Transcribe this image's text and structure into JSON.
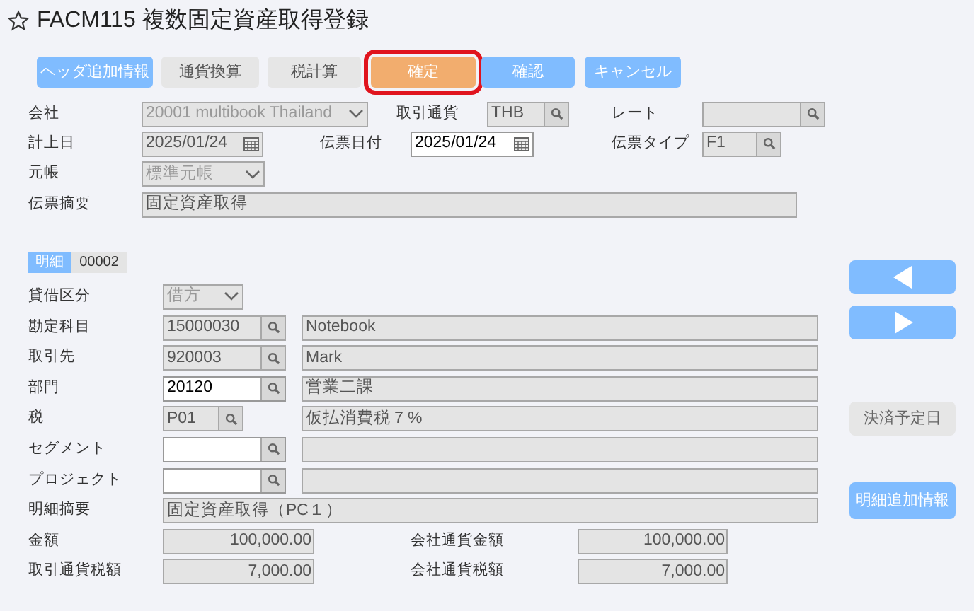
{
  "title": "FACM115 複数固定資産取得登録",
  "toolbar": [
    {
      "label": "ヘッダ追加情報",
      "kind": "primary"
    },
    {
      "label": "通貨換算",
      "kind": "secondary"
    },
    {
      "label": "税計算",
      "kind": "secondary"
    },
    {
      "label": "確定",
      "kind": "highlight"
    },
    {
      "label": "確認",
      "kind": "primary"
    },
    {
      "label": "キャンセル",
      "kind": "primary"
    }
  ],
  "header_rows": [
    [
      {
        "label": "会社",
        "value": "20001 multibook Thailand",
        "kind": "select",
        "editable": false
      },
      {
        "label": "取引通貨",
        "value": "THB",
        "kind": "lookup",
        "editable": false
      },
      {
        "label": "レート",
        "kind": "lookup",
        "editable": false
      }
    ],
    [
      {
        "label": "計上日",
        "value": "2025/01/24",
        "kind": "date",
        "editable": false
      },
      {
        "label": "伝票日付",
        "value": "2025/01/24",
        "kind": "date",
        "editable": true
      },
      {
        "label": "伝票タイプ",
        "value": "F1",
        "kind": "lookup",
        "editable": false
      }
    ],
    [
      {
        "label": "元帳",
        "value": "標準元帳",
        "kind": "select",
        "editable": false
      }
    ],
    [
      {
        "label": "伝票摘要",
        "value": "固定資産取得",
        "kind": "text",
        "editable": false
      }
    ]
  ],
  "detail_tab": {
    "label": "明細",
    "number": "00002"
  },
  "lines": [
    {
      "label": "貸借区分",
      "kind": "select",
      "code": "借方",
      "editable": false
    },
    {
      "label": "勘定科目",
      "kind": "lookup",
      "code": "15000030",
      "name": "Notebook",
      "editable": false
    },
    {
      "label": "取引先",
      "kind": "lookup",
      "code": "920003",
      "name": "Mark",
      "editable": false
    },
    {
      "label": "部門",
      "kind": "lookup",
      "code": "20120",
      "name": "営業二課",
      "editable": true
    },
    {
      "label": "税",
      "kind": "short_lookup",
      "code": "P01",
      "name": "仮払消費税７%",
      "editable": false
    },
    {
      "label": "セグメント",
      "kind": "lookup",
      "editable": true
    },
    {
      "label": "プロジェクト",
      "kind": "lookup",
      "editable": true
    },
    {
      "label": "明細摘要",
      "kind": "text",
      "code": "固定資産取得（PC１）",
      "editable": false
    }
  ],
  "amounts": [
    {
      "label": "金額",
      "value": "100,000.00",
      "company_label": "会社通貨金額",
      "company_value": "100,000.00"
    },
    {
      "label": "取引通貨税額",
      "value": "7,000.00",
      "company_label": "会社通貨税額",
      "company_value": "7,000.00"
    }
  ],
  "side_buttons": [
    {
      "kind": "prev"
    },
    {
      "kind": "next"
    },
    {
      "label": "決済予定日",
      "kind": "secondary"
    },
    {
      "label": "明細追加情報",
      "kind": "primary"
    }
  ]
}
